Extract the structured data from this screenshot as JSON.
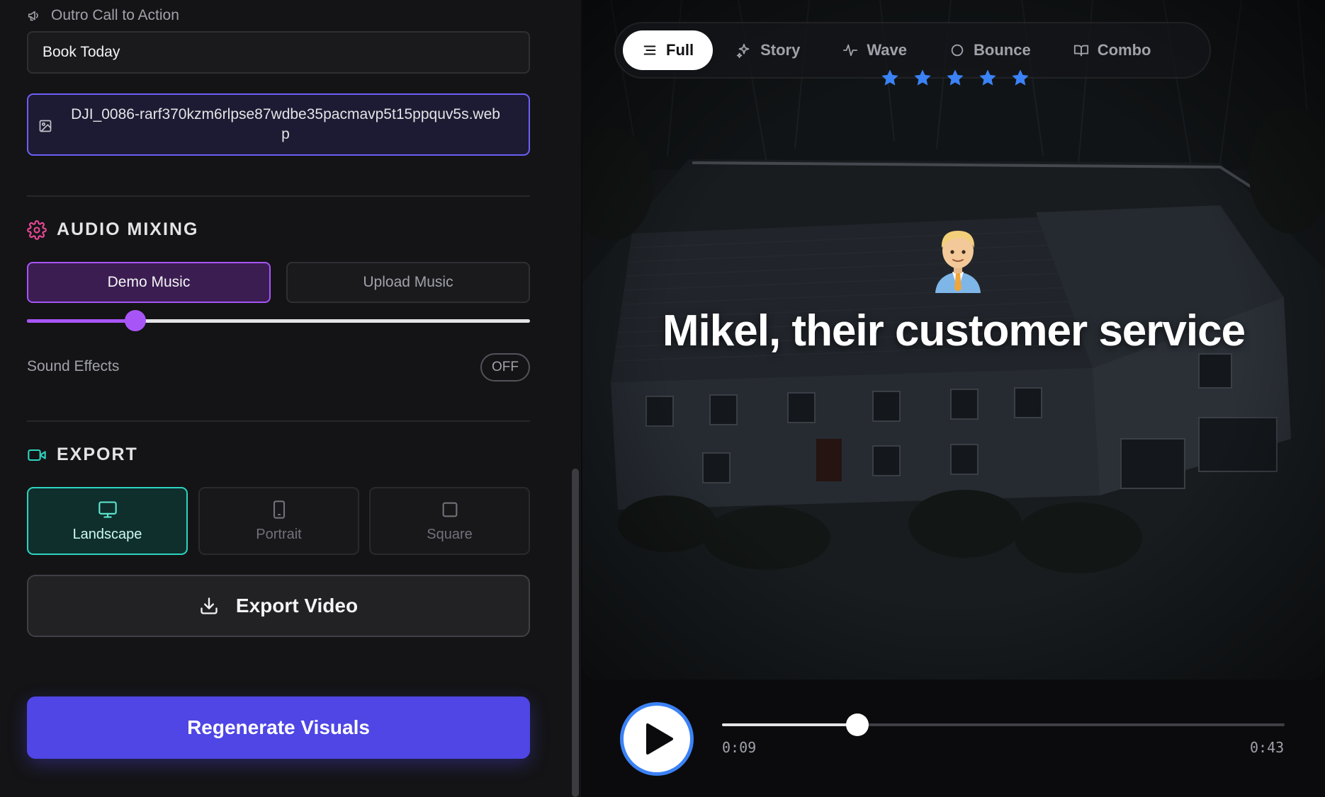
{
  "outro": {
    "label": "Outro Call to Action",
    "value": "Book Today",
    "file_name": "DJI_0086-rarf370kzm6rlpse87wdbe35pacmavp5t15ppquv5s.webp"
  },
  "audio": {
    "heading": "AUDIO MIXING",
    "demo_label": "Demo Music",
    "upload_label": "Upload Music",
    "volume_fraction": 0.215,
    "sfx_label": "Sound Effects",
    "sfx_state": "OFF"
  },
  "export": {
    "heading": "EXPORT",
    "formats": [
      {
        "label": "Landscape",
        "icon": "monitor-icon",
        "active": true
      },
      {
        "label": "Portrait",
        "icon": "phone-icon",
        "active": false
      },
      {
        "label": "Square",
        "icon": "square-icon",
        "active": false
      }
    ],
    "export_label": "Export Video"
  },
  "regenerate_label": "Regenerate Visuals",
  "preview": {
    "modes": [
      {
        "label": "Full",
        "icon": "lines-icon",
        "active": true
      },
      {
        "label": "Story",
        "icon": "sparkle-icon",
        "active": false
      },
      {
        "label": "Wave",
        "icon": "pulse-icon",
        "active": false
      },
      {
        "label": "Bounce",
        "icon": "circle-icon",
        "active": false
      },
      {
        "label": "Combo",
        "icon": "book-icon",
        "active": false
      }
    ],
    "star_count": 5,
    "caption": "Mikel, their customer service",
    "emoji": "man-office-worker-emoji"
  },
  "player": {
    "current_time": "0:09",
    "duration": "0:43",
    "progress_fraction": 0.24
  },
  "colors": {
    "accent_purple": "#a855f7",
    "accent_indigo": "#4f46e5",
    "accent_teal": "#2dd4bf",
    "star_blue": "#3b82f6"
  }
}
